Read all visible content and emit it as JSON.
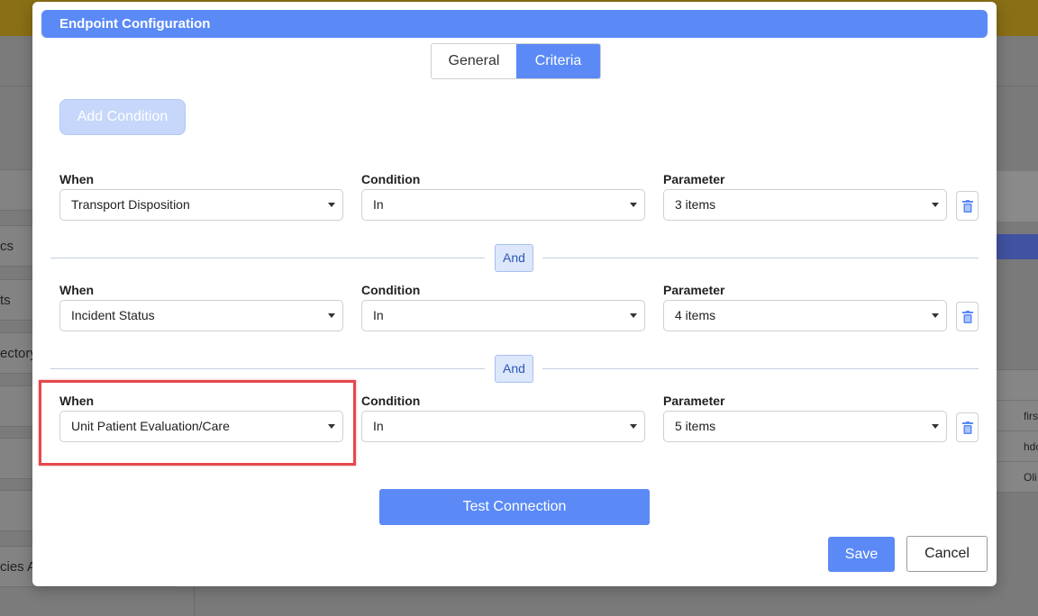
{
  "background": {
    "sidebar_items": [
      "cs",
      "ts",
      "ectory",
      "",
      "",
      "",
      "cies At"
    ],
    "table_cells": [
      "firs",
      "hdc",
      "Oli"
    ]
  },
  "modal": {
    "title": "Endpoint Configuration",
    "tabs": [
      {
        "label": "General",
        "active": false
      },
      {
        "label": "Criteria",
        "active": true
      }
    ],
    "add_condition_label": "Add Condition",
    "labels": {
      "when": "When",
      "condition": "Condition",
      "parameter": "Parameter"
    },
    "conditions": [
      {
        "when": "Transport Disposition",
        "condition": "In",
        "parameter": "3 items"
      },
      {
        "when": "Incident Status",
        "condition": "In",
        "parameter": "4 items"
      },
      {
        "when": "Unit Patient Evaluation/Care",
        "condition": "In",
        "parameter": "5 items"
      }
    ],
    "connector_label": "And",
    "test_connection_label": "Test Connection",
    "save_label": "Save",
    "cancel_label": "Cancel"
  },
  "colors": {
    "primary": "#5b8af7",
    "highlight": "#e5484d"
  }
}
